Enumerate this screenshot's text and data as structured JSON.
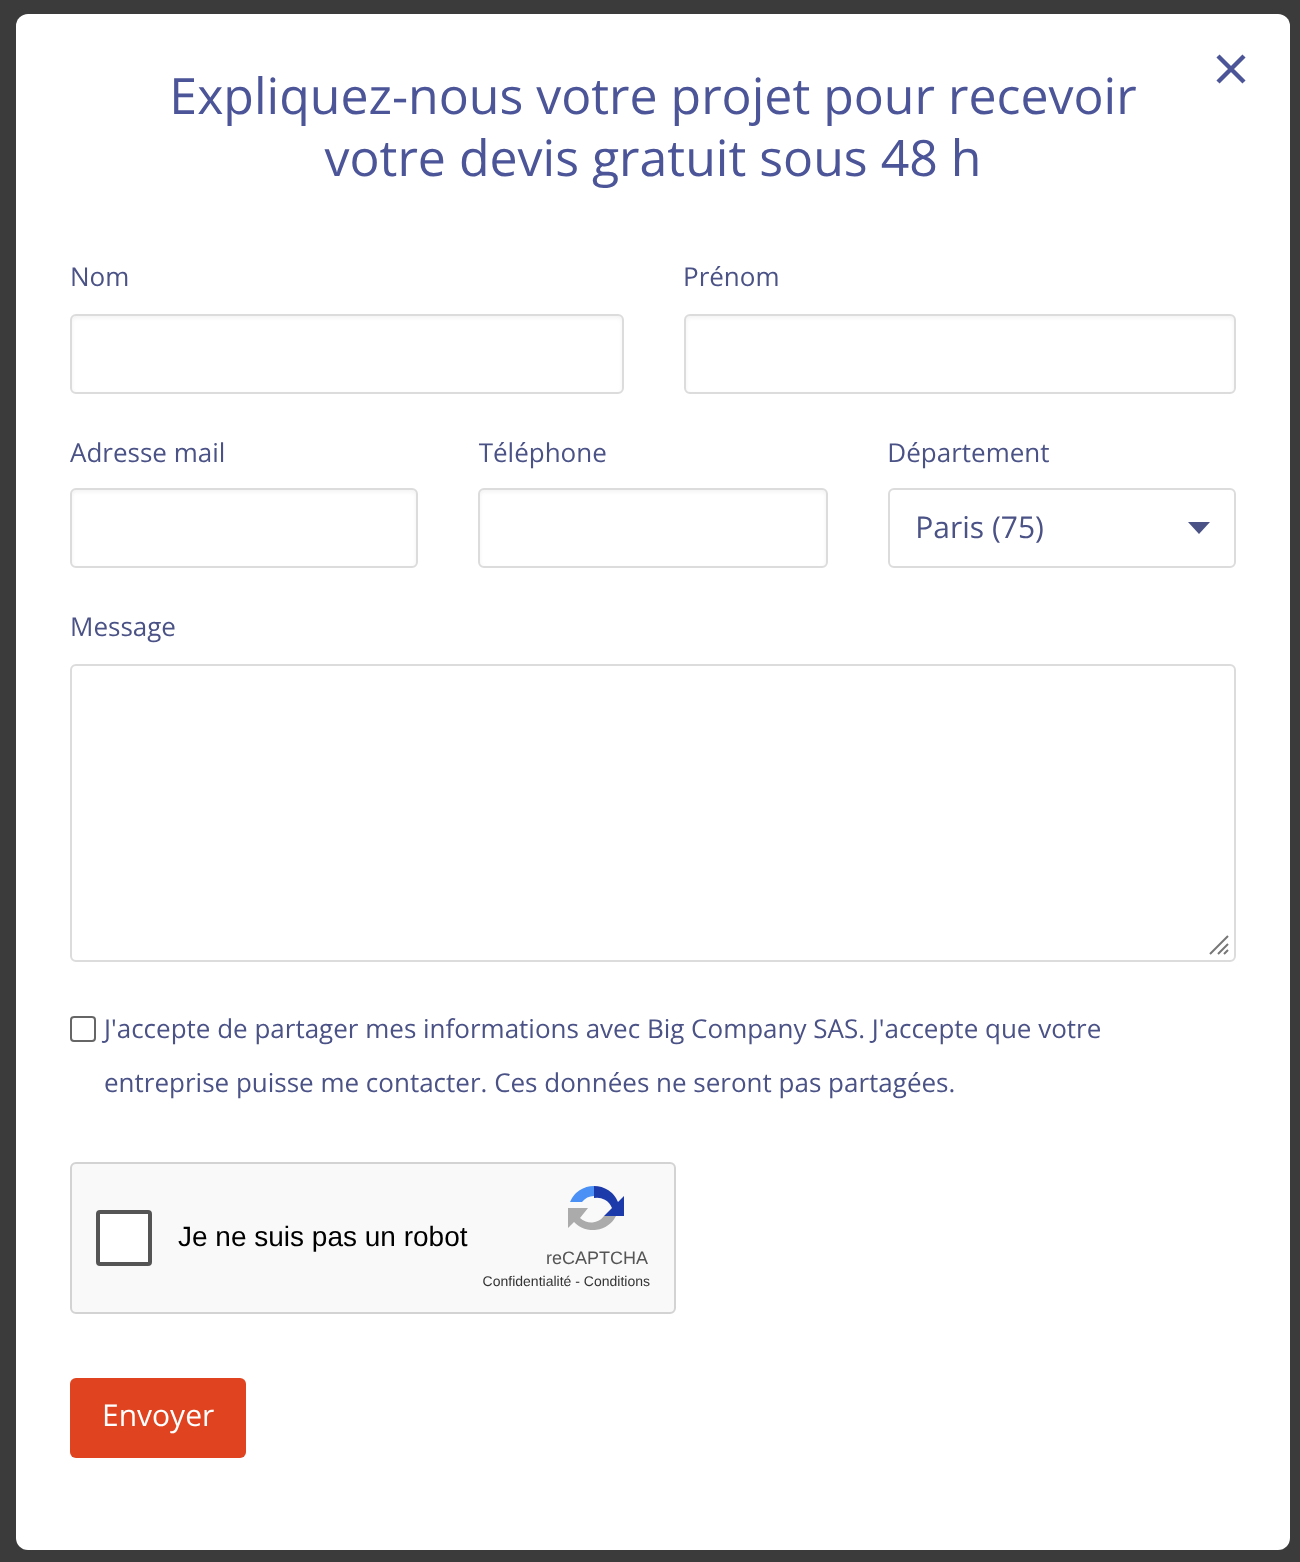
{
  "modal": {
    "title": "Expliquez-nous votre projet pour recevoir votre devis gratuit sous 48 h",
    "rows": [
      [
        {
          "label": "Nom",
          "kind": "text"
        },
        {
          "label": "Prénom",
          "kind": "text"
        }
      ],
      [
        {
          "label": "Adresse mail",
          "kind": "text"
        },
        {
          "label": "Téléphone",
          "kind": "text"
        },
        {
          "label": "Département",
          "kind": "select",
          "value": "Paris (75)"
        }
      ],
      [
        {
          "label": "Message",
          "kind": "textarea"
        }
      ]
    ],
    "consent": {
      "text": "J'accepte de partager mes informations avec Big Company SAS. J'accepte que votre entreprise puisse me contacter. Ces données ne seront pas partagées.",
      "checked": false
    },
    "captcha": {
      "label": "Je ne suis pas un robot",
      "checked": false,
      "brand": "reCAPTCHA",
      "links": [
        "Confidentialité",
        "Conditions"
      ],
      "separator": "-"
    },
    "submit": "Envoyer"
  }
}
